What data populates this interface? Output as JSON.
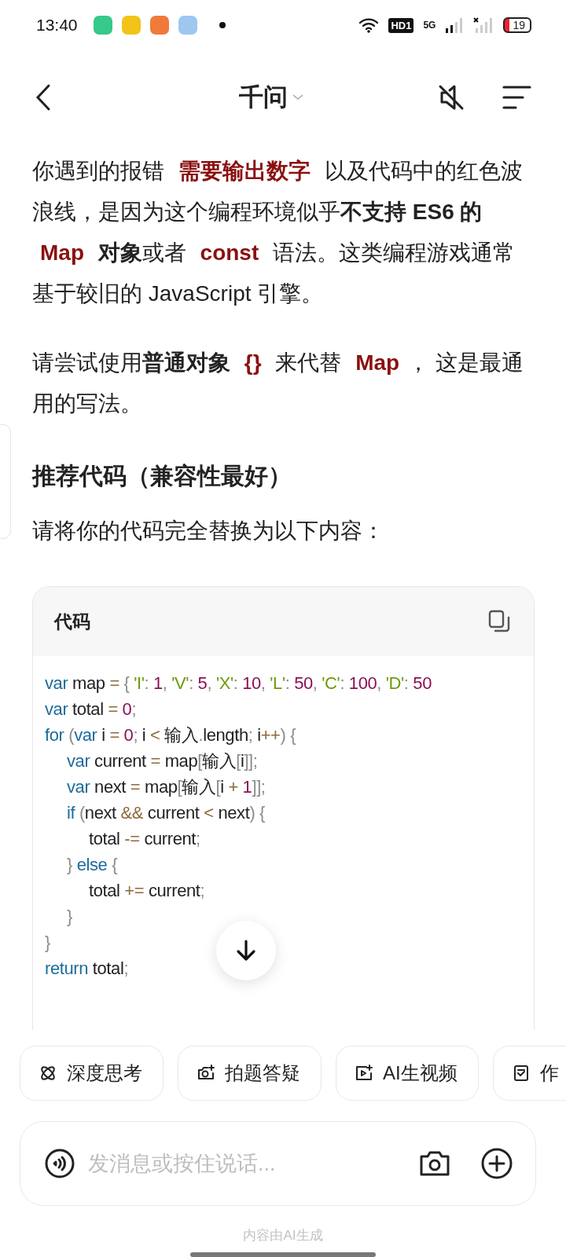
{
  "status_bar": {
    "time": "13:40",
    "hd_badge": "HD1",
    "network": "5G",
    "battery": "19"
  },
  "header": {
    "title": "千问"
  },
  "paragraphs": [
    {
      "kind": "text",
      "segments": [
        {
          "kind": "plain",
          "text": "你遇到的报错 "
        },
        {
          "kind": "code",
          "text": "需要输出数字"
        },
        {
          "kind": "plain",
          "text": " 以及代码中的红色波浪线，是因为这个编程环境似乎"
        },
        {
          "kind": "bold",
          "text": "不支持 ES6 的 "
        },
        {
          "kind": "code",
          "text": "Map"
        },
        {
          "kind": "bold",
          "text": " 对象"
        },
        {
          "kind": "plain",
          "text": "或者 "
        },
        {
          "kind": "code",
          "text": "const"
        },
        {
          "kind": "plain",
          "text": " 语法。这类编程游戏通常基于较旧的 JavaScript 引擎。"
        }
      ]
    },
    {
      "kind": "text",
      "segments": [
        {
          "kind": "plain",
          "text": "请尝试使用"
        },
        {
          "kind": "bold",
          "text": "普通对象 "
        },
        {
          "kind": "code",
          "text": "{}"
        },
        {
          "kind": "plain",
          "text": " 来代替 "
        },
        {
          "kind": "code",
          "text": "Map"
        },
        {
          "kind": "plain",
          "text": "， 这是最通用的写法。"
        }
      ]
    },
    {
      "kind": "heading",
      "segments": [
        {
          "kind": "plain",
          "text": "推荐代码（兼容性最好）"
        }
      ]
    },
    {
      "kind": "text",
      "segments": [
        {
          "kind": "plain",
          "text": "请将你的代码完全替换为以下内容："
        }
      ]
    }
  ],
  "code_block": {
    "title": "代码",
    "lines": [
      {
        "tokens": [
          {
            "kind": "keyword",
            "text": "var"
          },
          {
            "kind": "plain",
            "text": " map "
          },
          {
            "kind": "operator",
            "text": "="
          },
          {
            "kind": "punct",
            "text": " { "
          },
          {
            "kind": "string",
            "text": "'I'"
          },
          {
            "kind": "punct",
            "text": ": "
          },
          {
            "kind": "number",
            "text": "1"
          },
          {
            "kind": "punct",
            "text": ", "
          },
          {
            "kind": "string",
            "text": "'V'"
          },
          {
            "kind": "punct",
            "text": ": "
          },
          {
            "kind": "number",
            "text": "5"
          },
          {
            "kind": "punct",
            "text": ", "
          },
          {
            "kind": "string",
            "text": "'X'"
          },
          {
            "kind": "punct",
            "text": ": "
          },
          {
            "kind": "number",
            "text": "10"
          },
          {
            "kind": "punct",
            "text": ", "
          },
          {
            "kind": "string",
            "text": "'L'"
          },
          {
            "kind": "punct",
            "text": ": "
          },
          {
            "kind": "number",
            "text": "50"
          },
          {
            "kind": "punct",
            "text": ", "
          },
          {
            "kind": "string",
            "text": "'C'"
          },
          {
            "kind": "punct",
            "text": ": "
          },
          {
            "kind": "number",
            "text": "100"
          },
          {
            "kind": "punct",
            "text": ", "
          },
          {
            "kind": "string",
            "text": "'D'"
          },
          {
            "kind": "punct",
            "text": ": "
          },
          {
            "kind": "number",
            "text": "50"
          }
        ]
      },
      {
        "tokens": [
          {
            "kind": "keyword",
            "text": "var"
          },
          {
            "kind": "plain",
            "text": " total "
          },
          {
            "kind": "operator",
            "text": "="
          },
          {
            "kind": "number",
            "text": " 0"
          },
          {
            "kind": "punct",
            "text": ";"
          }
        ]
      },
      {
        "tokens": [
          {
            "kind": "keyword",
            "text": "for"
          },
          {
            "kind": "punct",
            "text": " ("
          },
          {
            "kind": "keyword",
            "text": "var"
          },
          {
            "kind": "plain",
            "text": " i "
          },
          {
            "kind": "operator",
            "text": "="
          },
          {
            "kind": "number",
            "text": " 0"
          },
          {
            "kind": "punct",
            "text": ";"
          },
          {
            "kind": "plain",
            "text": " i "
          },
          {
            "kind": "operator",
            "text": "<"
          },
          {
            "kind": "plain",
            "text": " 输入"
          },
          {
            "kind": "punct",
            "text": "."
          },
          {
            "kind": "plain",
            "text": "length"
          },
          {
            "kind": "punct",
            "text": ";"
          },
          {
            "kind": "plain",
            "text": " i"
          },
          {
            "kind": "operator",
            "text": "++"
          },
          {
            "kind": "punct",
            "text": ") {"
          }
        ],
        "children": [
          {
            "tokens": [
              {
                "kind": "keyword",
                "text": "var"
              },
              {
                "kind": "plain",
                "text": " current "
              },
              {
                "kind": "operator",
                "text": "="
              },
              {
                "kind": "plain",
                "text": " map"
              },
              {
                "kind": "punct",
                "text": "["
              },
              {
                "kind": "plain",
                "text": "输入"
              },
              {
                "kind": "punct",
                "text": "["
              },
              {
                "kind": "plain",
                "text": "i"
              },
              {
                "kind": "punct",
                "text": "]];"
              }
            ]
          },
          {
            "tokens": [
              {
                "kind": "keyword",
                "text": "var"
              },
              {
                "kind": "plain",
                "text": " next "
              },
              {
                "kind": "operator",
                "text": "="
              },
              {
                "kind": "plain",
                "text": " map"
              },
              {
                "kind": "punct",
                "text": "["
              },
              {
                "kind": "plain",
                "text": "输入"
              },
              {
                "kind": "punct",
                "text": "["
              },
              {
                "kind": "plain",
                "text": "i "
              },
              {
                "kind": "operator",
                "text": "+"
              },
              {
                "kind": "number",
                "text": " 1"
              },
              {
                "kind": "punct",
                "text": "]];"
              }
            ]
          },
          {
            "tokens": [
              {
                "kind": "keyword",
                "text": "if"
              },
              {
                "kind": "punct",
                "text": " ("
              },
              {
                "kind": "plain",
                "text": "next "
              },
              {
                "kind": "operator",
                "text": "&&"
              },
              {
                "kind": "plain",
                "text": " current "
              },
              {
                "kind": "operator",
                "text": "<"
              },
              {
                "kind": "plain",
                "text": " next"
              },
              {
                "kind": "punct",
                "text": ") {"
              }
            ],
            "children": [
              {
                "tokens": [
                  {
                    "kind": "plain",
                    "text": "total "
                  },
                  {
                    "kind": "operator",
                    "text": "-="
                  },
                  {
                    "kind": "plain",
                    "text": " current"
                  },
                  {
                    "kind": "punct",
                    "text": ";"
                  }
                ]
              }
            ]
          },
          {
            "tokens": [
              {
                "kind": "punct",
                "text": "} "
              },
              {
                "kind": "keyword",
                "text": "else"
              },
              {
                "kind": "punct",
                "text": " {"
              }
            ],
            "children": [
              {
                "tokens": [
                  {
                    "kind": "plain",
                    "text": "total "
                  },
                  {
                    "kind": "operator",
                    "text": "+="
                  },
                  {
                    "kind": "plain",
                    "text": " current"
                  },
                  {
                    "kind": "punct",
                    "text": ";"
                  }
                ]
              }
            ]
          },
          {
            "tokens": [
              {
                "kind": "punct",
                "text": "}"
              }
            ]
          }
        ]
      },
      {
        "tokens": [
          {
            "kind": "punct",
            "text": "}"
          }
        ]
      },
      {
        "tokens": [
          {
            "kind": "keyword",
            "text": "return"
          },
          {
            "kind": "plain",
            "text": " total"
          },
          {
            "kind": "punct",
            "text": ";"
          }
        ]
      }
    ]
  },
  "chips": [
    {
      "kind": "think",
      "label": "深度思考"
    },
    {
      "kind": "photo",
      "label": "拍题答疑"
    },
    {
      "kind": "video",
      "label": "AI生视频"
    },
    {
      "kind": "doc",
      "label": "作"
    }
  ],
  "composer": {
    "placeholder": "发消息或按住说话..."
  },
  "footer_note": "内容由AI生成"
}
